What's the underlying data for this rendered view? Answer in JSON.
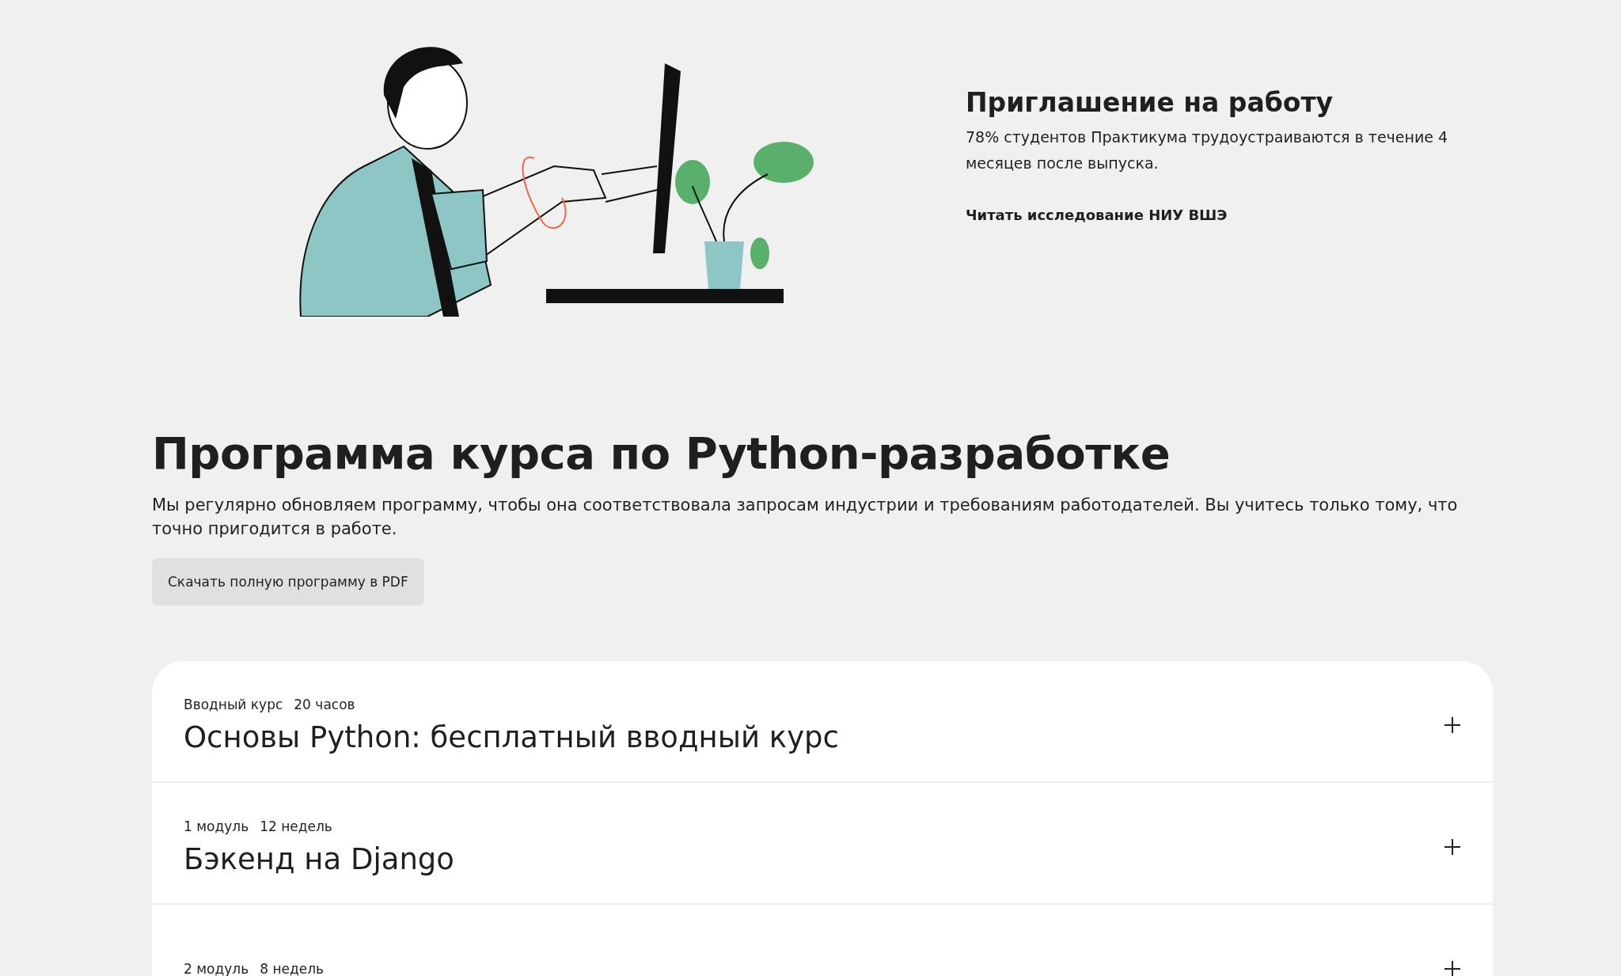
{
  "offer": {
    "title": "Приглашение на работу",
    "text": "78% студентов Практикума трудоустраиваются в течение 4 месяцев после выпуска.",
    "link": "Читать исследование НИУ ВШЭ"
  },
  "program": {
    "title": "Программа курса по Python-разработке",
    "text": "Мы регулярно обновляем программу, чтобы она соответствовала запросам индустрии и требованиям работодателей. Вы учитесь только тому, что точно пригодится в работе.",
    "button": "Скачать полную программу в PDF"
  },
  "modules": [
    {
      "label": "Вводный курс",
      "duration": "20 часов",
      "title": "Основы Python: бесплатный вводный курс",
      "expanded": false
    },
    {
      "label": "1 модуль",
      "duration": "12 недель",
      "title": "Бэкенд на Django",
      "expanded": false
    },
    {
      "label": "2 модуль",
      "duration": "8 недель",
      "expanded": false
    }
  ]
}
